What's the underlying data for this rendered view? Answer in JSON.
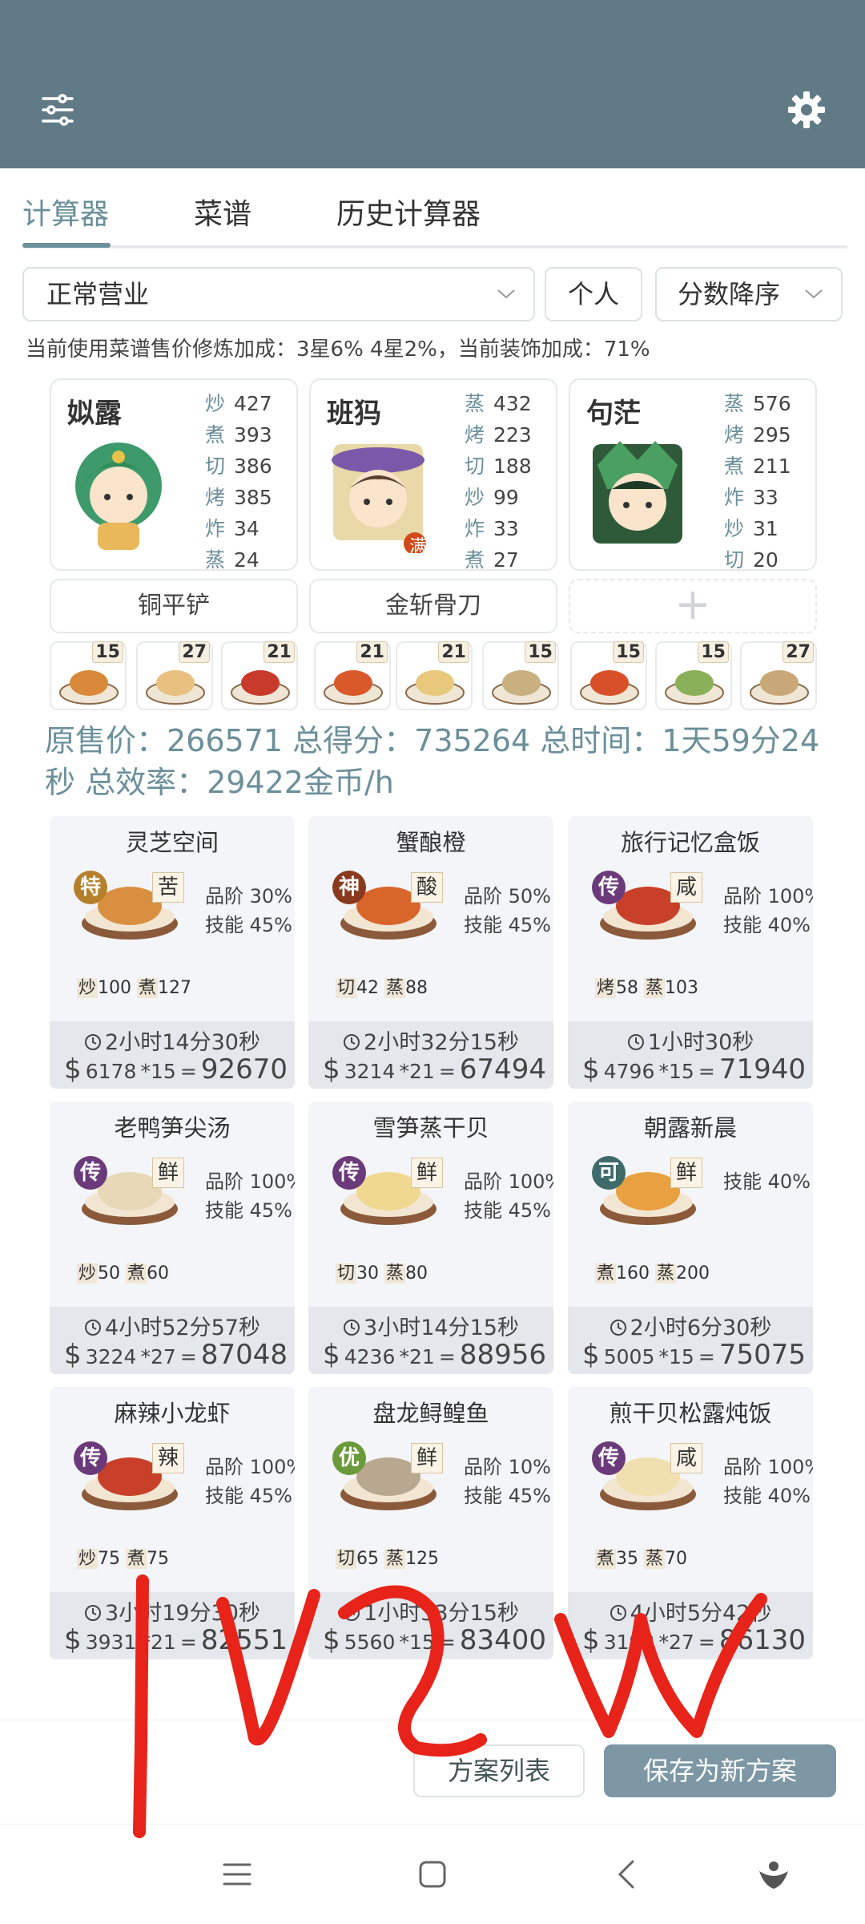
{
  "tabs": [
    "计算器",
    "菜谱",
    "历史计算器"
  ],
  "filters": {
    "mode": "正常营业",
    "scope": "个人",
    "sort": "分数降序"
  },
  "info_line": "当前使用菜谱售价修炼加成：3星6% 4星2%，当前装饰加成：71%",
  "chefs": [
    {
      "name": "姒露",
      "stats": [
        [
          "炒",
          "427"
        ],
        [
          "煮",
          "393"
        ],
        [
          "切",
          "386"
        ],
        [
          "烤",
          "385"
        ],
        [
          "炸",
          "34"
        ],
        [
          "蒸",
          "24"
        ]
      ]
    },
    {
      "name": "班犸",
      "badge": "满",
      "stats": [
        [
          "蒸",
          "432"
        ],
        [
          "烤",
          "223"
        ],
        [
          "切",
          "188"
        ],
        [
          "炒",
          "99"
        ],
        [
          "炸",
          "33"
        ],
        [
          "煮",
          "27"
        ]
      ]
    },
    {
      "name": "句茫",
      "stats": [
        [
          "蒸",
          "576"
        ],
        [
          "烤",
          "295"
        ],
        [
          "煮",
          "211"
        ],
        [
          "炸",
          "33"
        ],
        [
          "炒",
          "31"
        ],
        [
          "切",
          "20"
        ]
      ]
    }
  ],
  "tools": [
    "铜平铲",
    "金斩骨刀",
    "+"
  ],
  "dish_quantities": [
    "15",
    "27",
    "21",
    "21",
    "21",
    "15",
    "15",
    "15",
    "27"
  ],
  "summary": "原售价：266571 总得分：735264 总时间：1天59分24秒 总效率：29422金币/h",
  "recipes": [
    {
      "name": "灵芝空间",
      "badge": "特",
      "badge_color": "#b5802c",
      "taste": "苦",
      "quality": "品阶 30%",
      "skill": "技能 45%",
      "skills": [
        [
          "炒",
          "100"
        ],
        [
          "煮",
          "127"
        ]
      ],
      "time": "2小时14分30秒",
      "price": "6178",
      "qty": "*15",
      "total": "92670"
    },
    {
      "name": "蟹酿橙",
      "badge": "神",
      "badge_color": "#8a3a1e",
      "taste": "酸",
      "quality": "品阶 50%",
      "skill": "技能 45%",
      "skills": [
        [
          "切",
          "42"
        ],
        [
          "蒸",
          "88"
        ]
      ],
      "time": "2小时32分15秒",
      "price": "3214",
      "qty": "*21",
      "total": "67494"
    },
    {
      "name": "旅行记忆盒饭",
      "badge": "传",
      "badge_color": "#6b3a7a",
      "taste": "咸",
      "quality": "品阶 100%",
      "skill": "技能 40%",
      "skills": [
        [
          "烤",
          "58"
        ],
        [
          "蒸",
          "103"
        ]
      ],
      "time": "1小时30秒",
      "price": "4796",
      "qty": "*15",
      "total": "71940"
    },
    {
      "name": "老鸭笋尖汤",
      "badge": "传",
      "badge_color": "#6b3a7a",
      "taste": "鲜",
      "quality": "品阶 100%",
      "skill": "技能 45%",
      "skills": [
        [
          "炒",
          "50"
        ],
        [
          "煮",
          "60"
        ]
      ],
      "time": "4小时52分57秒",
      "price": "3224",
      "qty": "*27",
      "total": "87048"
    },
    {
      "name": "雪笋蒸干贝",
      "badge": "传",
      "badge_color": "#6b3a7a",
      "taste": "鲜",
      "quality": "品阶 100%",
      "skill": "技能 45%",
      "skills": [
        [
          "切",
          "30"
        ],
        [
          "蒸",
          "80"
        ]
      ],
      "time": "3小时14分15秒",
      "price": "4236",
      "qty": "*21",
      "total": "88956"
    },
    {
      "name": "朝露新晨",
      "badge": "可",
      "badge_color": "#3f6a6a",
      "taste": "鲜",
      "quality": "",
      "skill": "技能 40%",
      "skills": [
        [
          "煮",
          "160"
        ],
        [
          "蒸",
          "200"
        ]
      ],
      "time": "2小时6分30秒",
      "price": "5005",
      "qty": "*15",
      "total": "75075"
    },
    {
      "name": "麻辣小龙虾",
      "badge": "传",
      "badge_color": "#6b3a7a",
      "taste": "辣",
      "quality": "品阶 100%",
      "skill": "技能 45%",
      "skills": [
        [
          "炒",
          "75"
        ],
        [
          "煮",
          "75"
        ]
      ],
      "time": "3小时19分30秒",
      "price": "3931",
      "qty": "*21",
      "total": "82551"
    },
    {
      "name": "盘龙鲟鳇鱼",
      "badge": "优",
      "badge_color": "#6a9a3a",
      "taste": "鲜",
      "quality": "品阶 10%",
      "skill": "技能 45%",
      "skills": [
        [
          "切",
          "65"
        ],
        [
          "蒸",
          "125"
        ]
      ],
      "time": "1小时33分15秒",
      "price": "5560",
      "qty": "*15",
      "total": "83400"
    },
    {
      "name": "煎干贝松露炖饭",
      "badge": "传",
      "badge_color": "#6b3a7a",
      "taste": "咸",
      "quality": "品阶 100%",
      "skill": "技能 40%",
      "skills": [
        [
          "煮",
          "35"
        ],
        [
          "蒸",
          "70"
        ]
      ],
      "time": "4小时5分42秒",
      "price": "3193",
      "qty": "*27",
      "total": "86130"
    }
  ],
  "buttons": {
    "plan_list": "方案列表",
    "save_plan": "保存为新方案"
  },
  "overlay_handwriting": "1v2w",
  "colors": {
    "header": "#617b86",
    "accent": "#6b8f9b",
    "save_button": "#7d98a4",
    "scribble": "#e8231a"
  },
  "icons": [
    "sliders-icon",
    "gear-icon",
    "chevron-down-icon",
    "clock-icon",
    "menu-nav-icon",
    "home-nav-icon",
    "back-nav-icon",
    "assistant-nav-icon"
  ]
}
